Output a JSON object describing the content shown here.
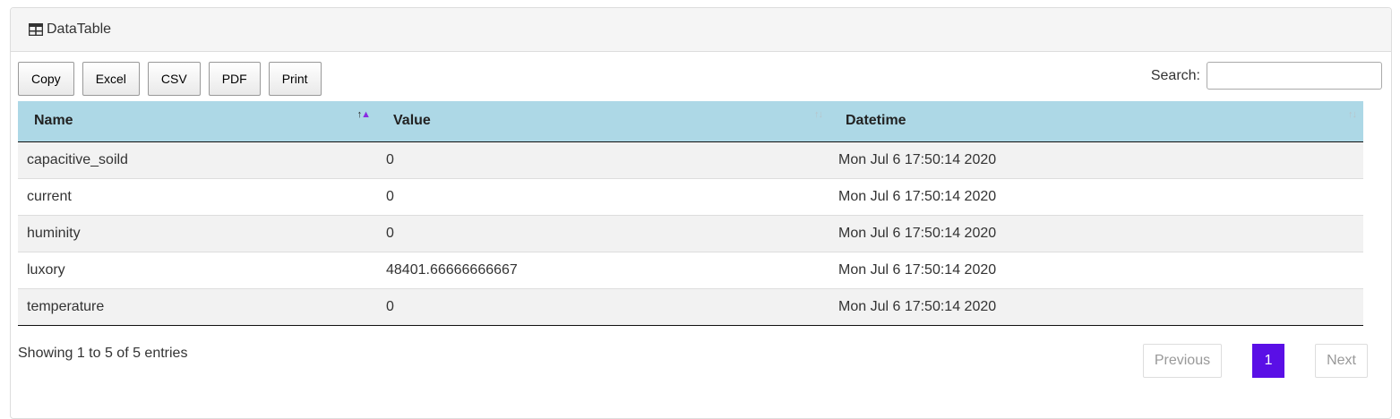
{
  "panel": {
    "title": "DataTable",
    "icon": "table-icon"
  },
  "toolbar": {
    "buttons": [
      "Copy",
      "Excel",
      "CSV",
      "PDF",
      "Print"
    ]
  },
  "search": {
    "label": "Search:",
    "value": "",
    "placeholder": ""
  },
  "table": {
    "columns": [
      {
        "label": "Name",
        "sort": "ascending"
      },
      {
        "label": "Value",
        "sort": "none"
      },
      {
        "label": "Datetime",
        "sort": "none"
      }
    ],
    "rows": [
      [
        "capacitive_soild",
        "0",
        "Mon Jul 6 17:50:14 2020"
      ],
      [
        "current",
        "0",
        "Mon Jul 6 17:50:14 2020"
      ],
      [
        "huminity",
        "0",
        "Mon Jul 6 17:50:14 2020"
      ],
      [
        "luxory",
        "48401.66666666667",
        "Mon Jul 6 17:50:14 2020"
      ],
      [
        "temperature",
        "0",
        "Mon Jul 6 17:50:14 2020"
      ]
    ]
  },
  "footer": {
    "info": "Showing 1 to 5 of 5 entries",
    "previous": "Previous",
    "current_page": "1",
    "next": "Next"
  },
  "colors": {
    "header_bg": "#add8e6",
    "accent": "#5a0fe6",
    "sort_active": "#8a2be2"
  }
}
